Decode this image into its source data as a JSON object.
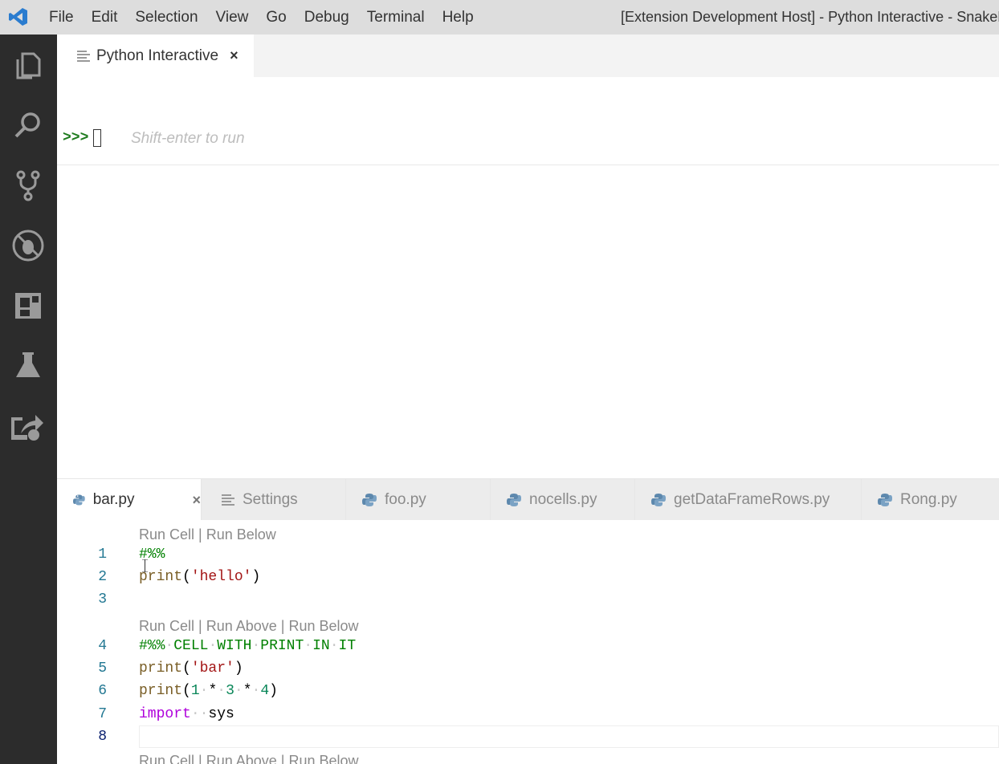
{
  "titlebar": {
    "menu": [
      "File",
      "Edit",
      "Selection",
      "View",
      "Go",
      "Debug",
      "Terminal",
      "Help"
    ],
    "window_title": "[Extension Development Host] - Python Interactive - SnakeP"
  },
  "activitybar": {
    "icons": [
      "explorer-icon",
      "search-icon",
      "source-control-icon",
      "debug-icon",
      "extensions-icon",
      "test-flask-icon",
      "live-share-icon"
    ]
  },
  "top_editor": {
    "tab": {
      "label": "Python Interactive",
      "close": "×"
    },
    "prompt": ">>>",
    "placeholder": "Shift-enter to run"
  },
  "bottom_editor": {
    "tabs": [
      {
        "label": "bar.py",
        "icon": "python-icon",
        "active": true,
        "close": "×"
      },
      {
        "label": "Settings",
        "icon": "settings-lines-icon",
        "active": false
      },
      {
        "label": "foo.py",
        "icon": "python-icon",
        "active": false
      },
      {
        "label": "nocells.py",
        "icon": "python-icon",
        "active": false
      },
      {
        "label": "getDataFrameRows.py",
        "icon": "python-icon",
        "active": false
      },
      {
        "label": "Rong.py",
        "icon": "python-icon",
        "active": false
      }
    ],
    "codelens": [
      "Run Cell | Run Below",
      "Run Cell | Run Above | Run Below",
      "Run Cell | Run Above | Run Below"
    ],
    "line_numbers": [
      "1",
      "2",
      "3",
      "4",
      "5",
      "6",
      "7",
      "8"
    ]
  },
  "colors": {
    "titlebar_bg": "#dddddd",
    "activitybar_bg": "#2c2c2c",
    "prompt_green": "#1e7b1e",
    "comment_green": "#008000",
    "string_red": "#a31515",
    "keyword_purple": "#af00db"
  }
}
